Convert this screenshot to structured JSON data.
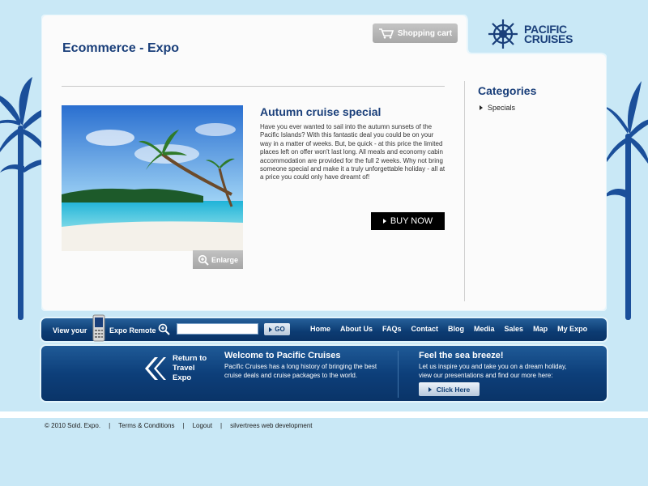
{
  "header": {
    "page_title": "Ecommerce - Expo",
    "cart_label": "Shopping cart",
    "logo_line1": "PACIFIC",
    "logo_line2": "CRUISES"
  },
  "product": {
    "title": "Autumn cruise special",
    "description": "Have you ever wanted to sail into the autumn sunsets of the Pacific Islands? With this fantastic deal you could be on your way in a matter of weeks. But, be quick - at this price the limited places left on offer won't last long. All meals and economy cabin accommodation are provided for the full 2 weeks. Why not bring someone special and make it a truly unforgettable holiday - all at a price you could only have dreamt of!",
    "enlarge_label": "Enlarge",
    "buy_label": "BUY NOW"
  },
  "categories": {
    "title": "Categories",
    "items": [
      "Specials"
    ]
  },
  "nav": {
    "view_your": "View your",
    "expo_remote": "Expo Remote",
    "search_value": "",
    "go_label": "GO",
    "links": [
      "Home",
      "About Us",
      "FAQs",
      "Contact",
      "Blog",
      "Media",
      "Sales",
      "Map",
      "My Expo"
    ]
  },
  "info": {
    "return_line1": "Return to",
    "return_line2": "Travel",
    "return_line3": "Expo",
    "welcome_title": "Welcome to Pacific Cruises",
    "welcome_text": "Pacific Cruises has a long history of bringing the best cruise deals and cruise packages to the world.",
    "sea_title": "Feel the sea breeze!",
    "sea_text": "Let us inspire you and take you on a dream holiday, view our presentations and find our more here:",
    "click_label": "Click Here"
  },
  "footer": {
    "copyright": "© 2010 Sold. Expo.",
    "terms": "Terms & Conditions",
    "logout": "Logout",
    "credit": "silvertrees web development",
    "separator": "|"
  },
  "colors": {
    "page_bg": "#c9e8f6",
    "brand_navy": "#1a3f7a",
    "bar_blue": "#0c3b72",
    "buy_black": "#000000"
  }
}
